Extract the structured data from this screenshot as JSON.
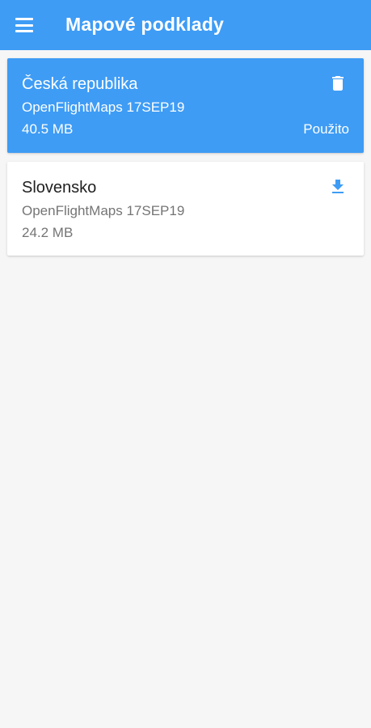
{
  "appbar": {
    "title": "Mapové podklady",
    "menu_icon": "menu-icon"
  },
  "maps": [
    {
      "name": "Česká republika",
      "source": "OpenFlightMaps 17SEP19",
      "size": "40.5 MB",
      "status": "Použito",
      "action_icon": "delete-icon",
      "selected": true
    },
    {
      "name": "Slovensko",
      "source": "OpenFlightMaps 17SEP19",
      "size": "24.2 MB",
      "action_icon": "download-icon",
      "selected": false
    }
  ],
  "colors": {
    "primary": "#3e9cf5",
    "background": "#f6f6f6",
    "card": "#ffffff"
  }
}
